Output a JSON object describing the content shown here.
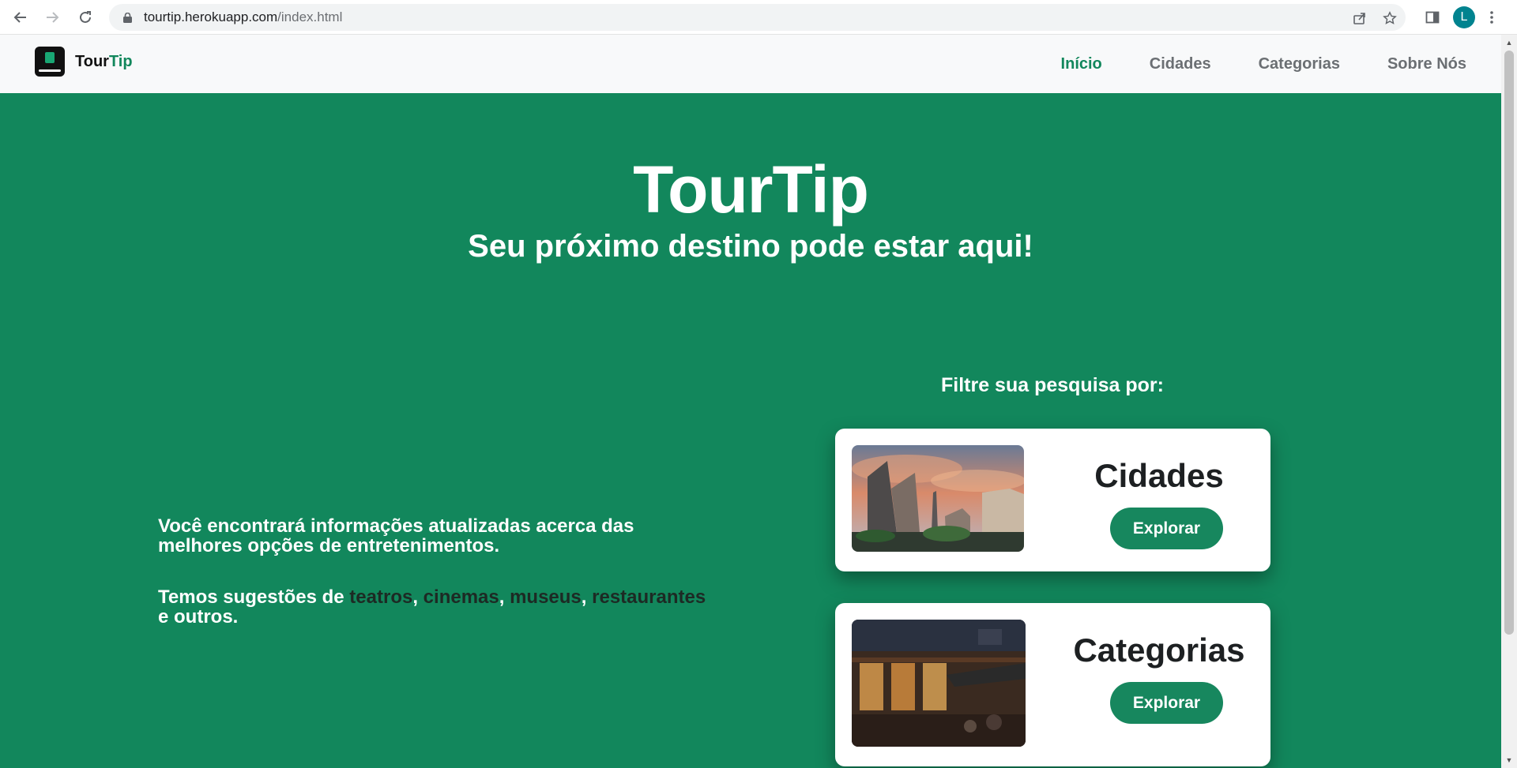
{
  "browser": {
    "url_host": "tourtip.herokuapp.com",
    "url_path": "/index.html",
    "profile_initial": "L",
    "icons": [
      "back-icon",
      "forward-icon",
      "reload-icon",
      "lock-icon",
      "share-icon",
      "star-icon",
      "side-panel-icon",
      "menu-icon"
    ]
  },
  "site_nav": {
    "brand_main": "Tour",
    "brand_accent": "Tip",
    "links": [
      {
        "label": "Início",
        "active": true
      },
      {
        "label": "Cidades",
        "active": false
      },
      {
        "label": "Categorias",
        "active": false
      },
      {
        "label": "Sobre Nós",
        "active": false
      }
    ]
  },
  "hero": {
    "title": "TourTip",
    "subtitle": "Seu próximo destino pode estar aqui!"
  },
  "info": {
    "p1": "Você encontrará informações atualizadas acerca das melhores opções de entretenimentos.",
    "p2_prefix": "Temos sugestões de ",
    "p2_items": [
      "teatros",
      "cinemas",
      "museus",
      "restaurantes"
    ],
    "p2_sep": ", ",
    "p2_suffix": " e outros."
  },
  "filter": {
    "label": "Filtre sua pesquisa por:",
    "cards": [
      {
        "title": "Cidades",
        "button": "Explorar"
      },
      {
        "title": "Categorias",
        "button": "Explorar"
      }
    ]
  },
  "colors": {
    "primary": "#12875c",
    "nav_bg": "#f8f9fa",
    "highlight_text": "#1d2a24"
  }
}
